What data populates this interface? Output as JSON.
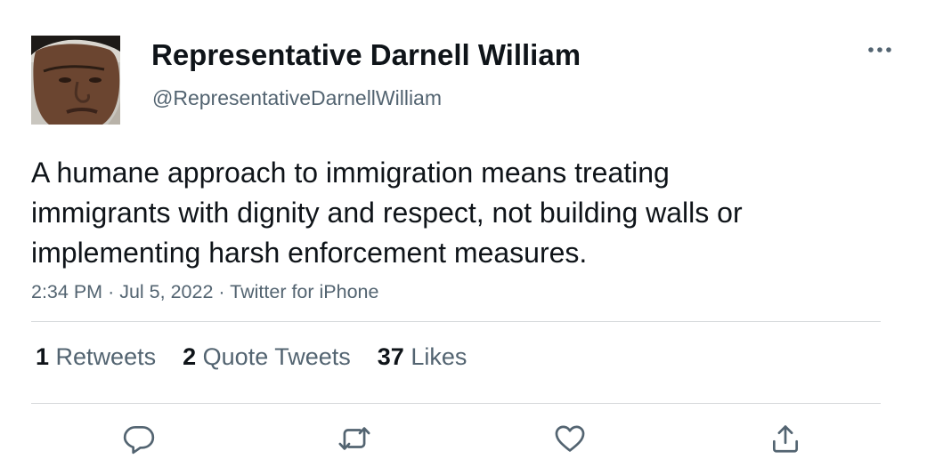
{
  "author": {
    "display_name": "Representative Darnell William",
    "handle": "@RepresentativeDarnellWilliam",
    "avatar_icon": "profile-photo"
  },
  "tweet": {
    "text": "A humane approach to immigration means treating immigrants with dignity and respect, not building walls or implementing harsh enforcement measures.",
    "time": "2:34 PM",
    "date": "Jul 5, 2022",
    "source": "Twitter for iPhone",
    "separator": "·"
  },
  "stats": {
    "retweets": {
      "count": "1",
      "label": "Retweets"
    },
    "quote_tweets": {
      "count": "2",
      "label": "Quote Tweets"
    },
    "likes": {
      "count": "37",
      "label": "Likes"
    }
  },
  "actions": [
    {
      "name": "reply",
      "icon": "speech-bubble-icon"
    },
    {
      "name": "retweet",
      "icon": "retweet-arrows-icon"
    },
    {
      "name": "like",
      "icon": "heart-icon"
    },
    {
      "name": "share",
      "icon": "upload-share-icon"
    }
  ],
  "colors": {
    "text_primary": "#0f1419",
    "text_secondary": "#536471",
    "divider": "#d6d9db",
    "background": "#ffffff"
  }
}
